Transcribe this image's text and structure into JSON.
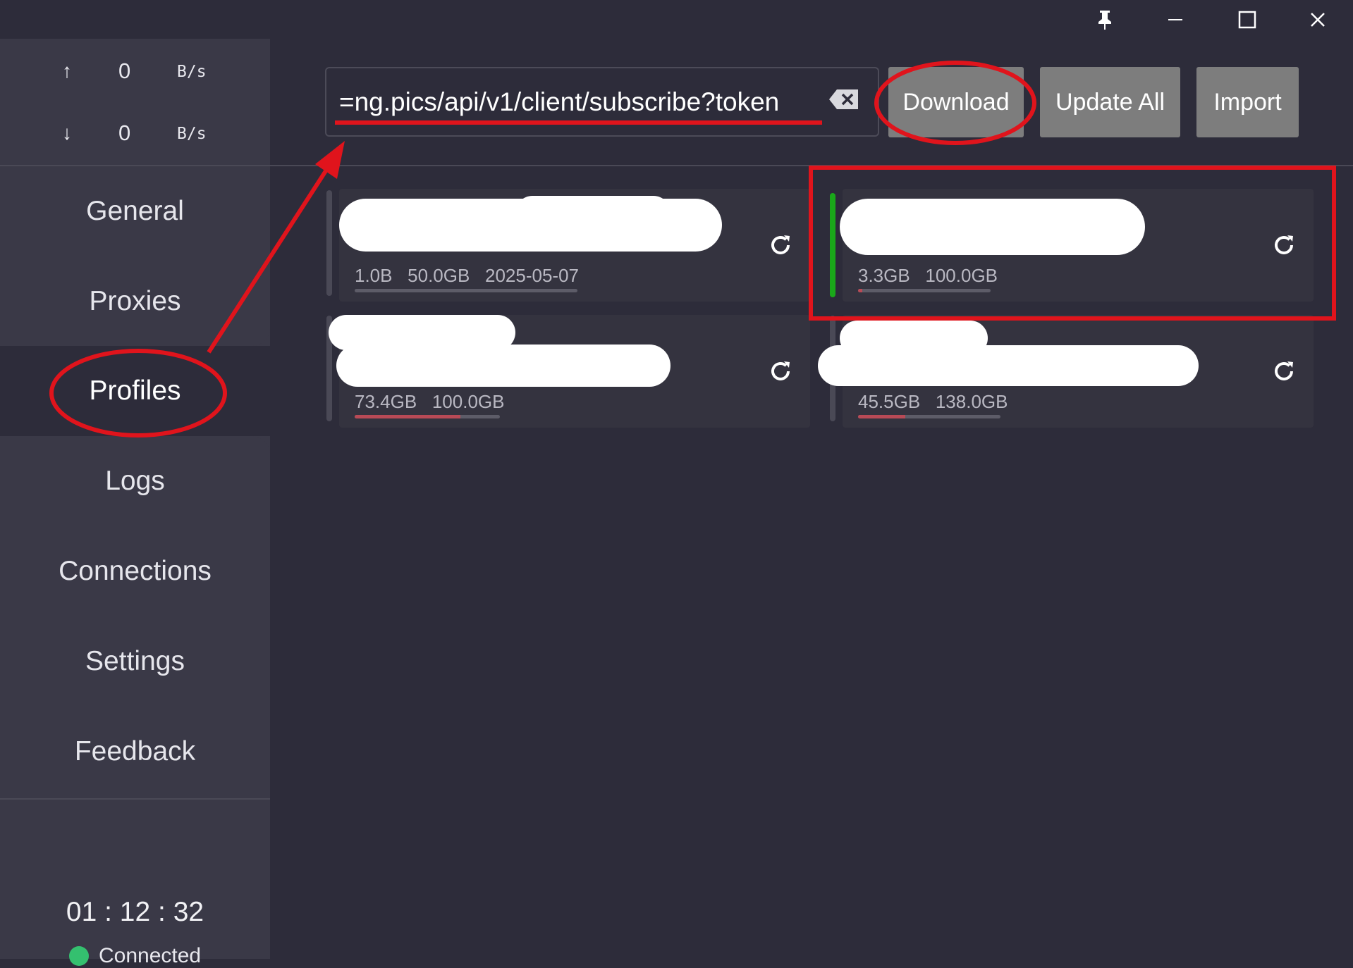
{
  "window": {
    "controls": [
      {
        "name": "pin-icon"
      },
      {
        "name": "minimize-icon"
      },
      {
        "name": "maximize-icon"
      },
      {
        "name": "close-icon"
      }
    ]
  },
  "traffic": {
    "up": {
      "arrow": "↑",
      "value": "0",
      "unit": "B/s"
    },
    "down": {
      "arrow": "↓",
      "value": "0",
      "unit": "B/s"
    }
  },
  "nav": {
    "general": "General",
    "proxies": "Proxies",
    "profiles": "Profiles",
    "logs": "Logs",
    "connections": "Connections",
    "settings": "Settings",
    "feedback": "Feedback"
  },
  "footer": {
    "timer": "01 : 12 : 32",
    "status": "Connected",
    "status_color": "#34c06f"
  },
  "toolbar": {
    "url_value": "ng.pics/api/v1/client/subscribe?token=",
    "download": "Download",
    "update_all": "Update All",
    "import": "Import"
  },
  "profiles": [
    {
      "meta": "1.0B   50.0GB   2025-05-07",
      "usage": 0.0,
      "active": false
    },
    {
      "meta": "3.3GB   100.0GB",
      "usage": 0.03,
      "active": true
    },
    {
      "meta": "73.4GB   100.0GB",
      "usage": 0.73,
      "active": false
    },
    {
      "meta": "45.5GB   138.0GB",
      "usage": 0.33,
      "active": false
    }
  ],
  "colors": {
    "accent_active": "#1aa81a",
    "annotation_red": "#e0141c"
  }
}
